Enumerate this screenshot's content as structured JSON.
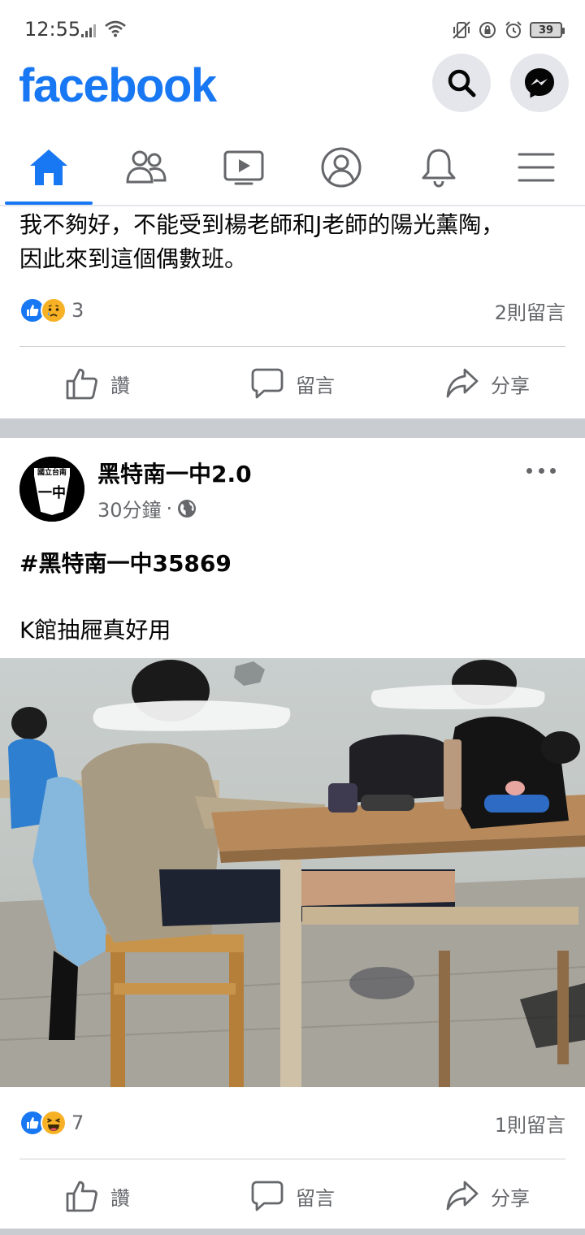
{
  "status_bar": {
    "time": "12:55",
    "battery": "39",
    "icons": [
      "signal-icon",
      "wifi-icon",
      "vibrate-icon",
      "rotation-lock-icon",
      "alarm-icon",
      "battery-icon"
    ]
  },
  "header": {
    "logo": "facebook",
    "brand_color": "#1877f2",
    "buttons": [
      "search-icon",
      "messenger-icon"
    ]
  },
  "tabs": [
    {
      "name": "home",
      "icon": "home-icon",
      "active": true
    },
    {
      "name": "friends",
      "icon": "friends-icon",
      "active": false
    },
    {
      "name": "watch",
      "icon": "video-icon",
      "active": false
    },
    {
      "name": "profile",
      "icon": "profile-icon",
      "active": false
    },
    {
      "name": "notifications",
      "icon": "bell-icon",
      "active": false
    },
    {
      "name": "menu",
      "icon": "menu-icon",
      "active": false
    }
  ],
  "post1": {
    "text": "我不夠好，不能受到楊老師和J老師的陽光薰陶，\n因此來到這個偶數班。",
    "reaction_count": "3",
    "reactions": [
      "like",
      "sad"
    ],
    "comments": "2則留言"
  },
  "actions": {
    "like": "讚",
    "comment": "留言",
    "share": "分享"
  },
  "post2": {
    "page_name": "黑特南一中2.0",
    "avatar_text_top": "國立台南",
    "avatar_text_main": "一中",
    "time": "30分鐘",
    "separator": "·",
    "privacy_icon": "globe-icon",
    "hashtag": "#黑特南一中35869",
    "text": "K館抽屜真好用",
    "reaction_count": "7",
    "reactions": [
      "like",
      "haha"
    ],
    "comments": "1則留言"
  }
}
